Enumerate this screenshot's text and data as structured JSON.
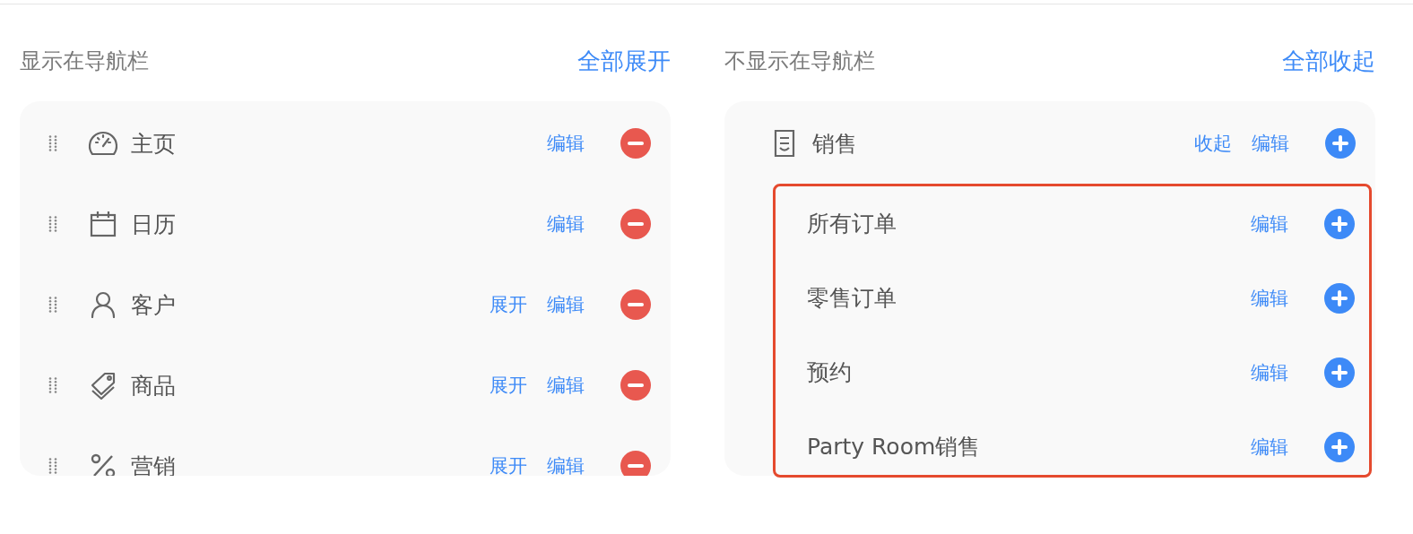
{
  "shown": {
    "title": "显示在导航栏",
    "toggle_all": "全部展开",
    "items": [
      {
        "label": "主页",
        "edit": "编辑"
      },
      {
        "label": "日历",
        "edit": "编辑"
      },
      {
        "label": "客户",
        "expand": "展开",
        "edit": "编辑"
      },
      {
        "label": "商品",
        "expand": "展开",
        "edit": "编辑"
      },
      {
        "label": "营销",
        "expand": "展开",
        "edit": "编辑"
      }
    ]
  },
  "hidden": {
    "title": "不显示在导航栏",
    "toggle_all": "全部收起",
    "groups": [
      {
        "label": "销售",
        "collapse": "收起",
        "edit": "编辑",
        "highlighted": true,
        "children": [
          {
            "label": "所有订单",
            "edit": "编辑"
          },
          {
            "label": "零售订单",
            "edit": "编辑"
          },
          {
            "label": "预约",
            "edit": "编辑"
          },
          {
            "label": "Party Room销售",
            "edit": "编辑"
          }
        ]
      }
    ]
  }
}
